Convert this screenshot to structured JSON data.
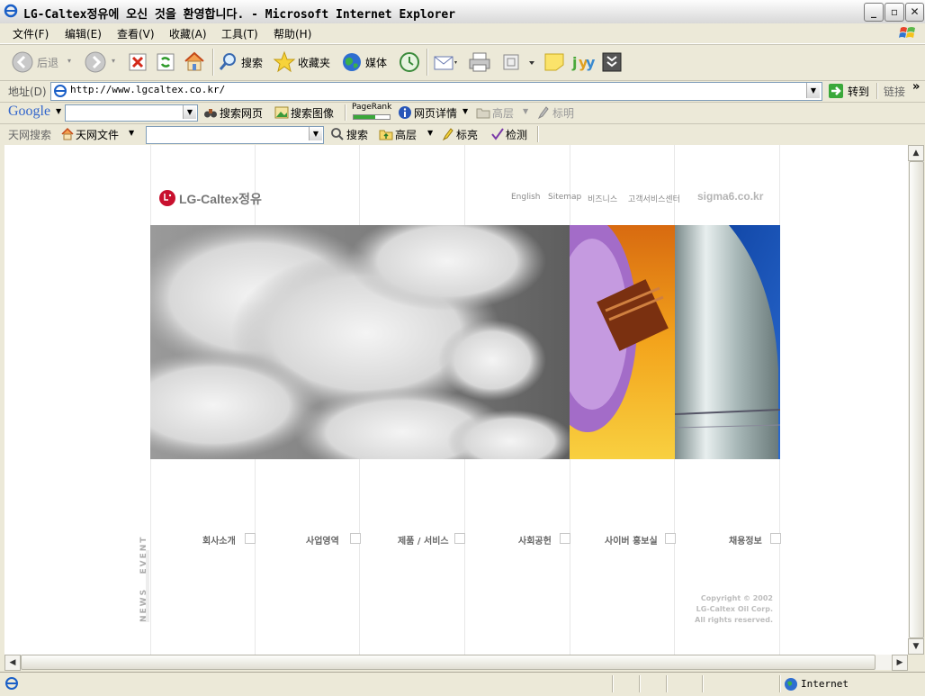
{
  "window": {
    "title": "LG-Caltex정유에 오신 것을 환영합니다. - Microsoft Internet Explorer",
    "controls": {
      "minimize": "_",
      "restore": "▫",
      "close": "✕"
    }
  },
  "menu": {
    "items": [
      "文件(F)",
      "编辑(E)",
      "查看(V)",
      "收藏(A)",
      "工具(T)",
      "帮助(H)"
    ]
  },
  "toolbar": {
    "back": "后退",
    "search": "搜索",
    "favorites": "收藏夹",
    "media": "媒体"
  },
  "address": {
    "label": "地址(D)",
    "url": "http://www.lgcaltex.co.kr/",
    "go": "转到",
    "links": "链接"
  },
  "google_bar": {
    "logo": "Google",
    "search_web": "搜索网页",
    "search_images": "搜索图像",
    "pagerank": "PageRank",
    "page_info": "网页详情",
    "up": "高层",
    "highlight": "标明"
  },
  "tianwang_bar": {
    "label": "天网搜索",
    "files": "天网文件",
    "search": "搜索",
    "up": "高层",
    "highlight": "标亮",
    "check": "检测"
  },
  "page": {
    "logo": "LG-Caltex정유",
    "top_links": [
      "English",
      "Sitemap",
      "비즈니스",
      "고객서비스센터"
    ],
    "sigma": "sigma6.co.kr",
    "nav": [
      "회사소개",
      "사업영역",
      "제품 / 서비스",
      "사회공헌",
      "사이버 홍보실",
      "채용정보"
    ],
    "news_event": "NEWS   EVENT",
    "copyright": [
      "Copyright © 2002",
      "LG-Caltex Oil Corp.",
      "All rights reserved."
    ]
  },
  "status": {
    "zone": "Internet"
  },
  "colors": {
    "lg_red": "#c8102e",
    "sky_blue": "#1f4ea8",
    "orange": "#f0a020",
    "purple": "#a070c0"
  }
}
